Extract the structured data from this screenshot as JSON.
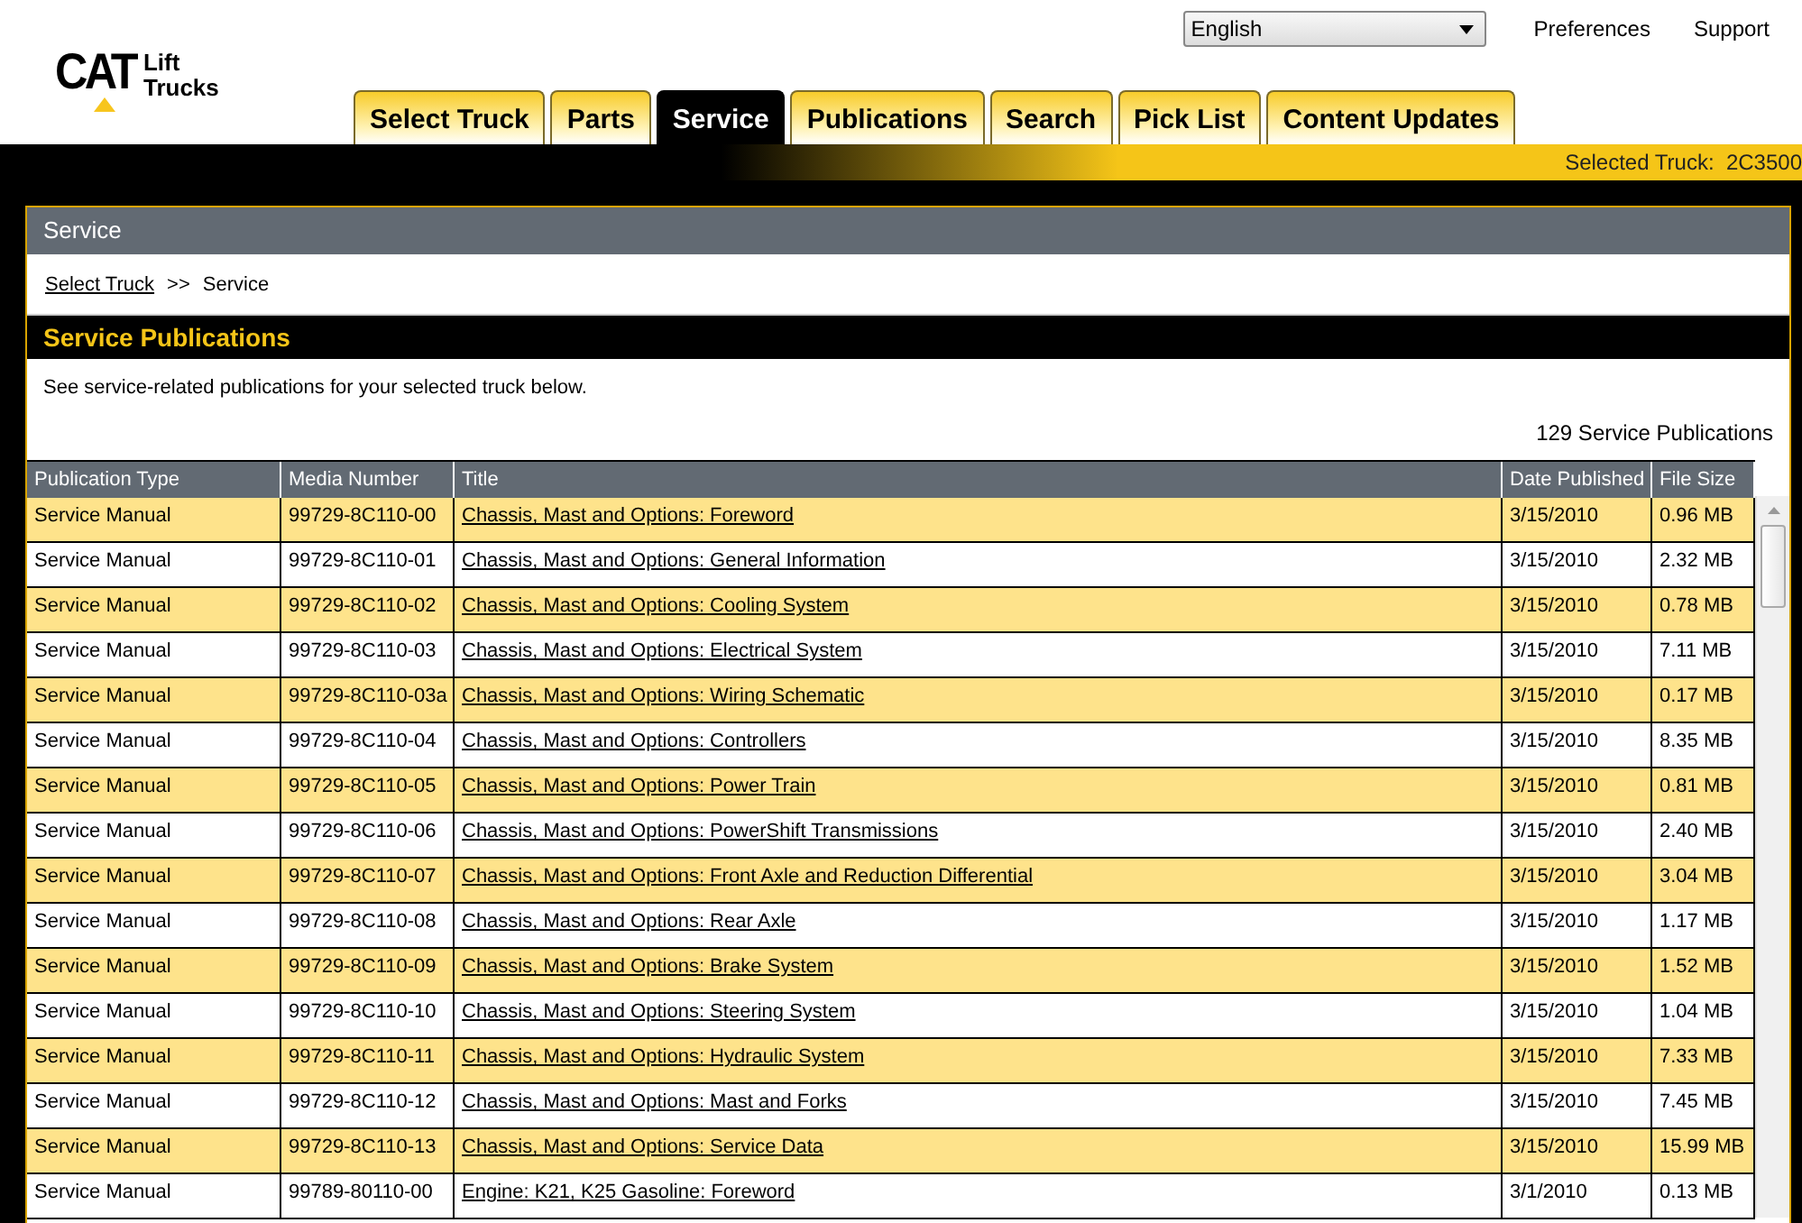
{
  "logo": {
    "brand": "CAT",
    "product_line_1": "Lift",
    "product_line_2": "Trucks"
  },
  "language_select": {
    "value": "English"
  },
  "header_links": [
    "Preferences",
    "Support"
  ],
  "tabs": [
    {
      "label": "Select Truck",
      "selected": false
    },
    {
      "label": "Parts",
      "selected": false
    },
    {
      "label": "Service",
      "selected": true
    },
    {
      "label": "Publications",
      "selected": false
    },
    {
      "label": "Search",
      "selected": false
    },
    {
      "label": "Pick List",
      "selected": false
    },
    {
      "label": "Content Updates",
      "selected": false
    }
  ],
  "selected_truck": {
    "label": "Selected Truck:",
    "value": "2C3500"
  },
  "panel": {
    "title": "Service",
    "breadcrumb": [
      {
        "label": "Select Truck",
        "kind": "link"
      },
      {
        "label": ">>",
        "kind": "separator"
      },
      {
        "label": "Service",
        "kind": "current"
      }
    ],
    "section_title": "Service Publications",
    "description": "See service-related publications for your selected truck below.",
    "count": "129 Service Publications"
  },
  "table": {
    "columns": [
      "Publication Type",
      "Media Number",
      "Title",
      "Date Published",
      "File Size"
    ],
    "rows": [
      [
        "Service Manual",
        "99729-8C110-00",
        "Chassis, Mast and Options: Foreword",
        "3/15/2010",
        "0.96 MB"
      ],
      [
        "Service Manual",
        "99729-8C110-01",
        "Chassis, Mast and Options: General Information",
        "3/15/2010",
        "2.32 MB"
      ],
      [
        "Service Manual",
        "99729-8C110-02",
        "Chassis, Mast and Options: Cooling System",
        "3/15/2010",
        "0.78 MB"
      ],
      [
        "Service Manual",
        "99729-8C110-03",
        "Chassis, Mast and Options: Electrical System",
        "3/15/2010",
        "7.11 MB"
      ],
      [
        "Service Manual",
        "99729-8C110-03a",
        "Chassis, Mast and Options: Wiring Schematic",
        "3/15/2010",
        "0.17 MB"
      ],
      [
        "Service Manual",
        "99729-8C110-04",
        "Chassis, Mast and Options: Controllers",
        "3/15/2010",
        "8.35 MB"
      ],
      [
        "Service Manual",
        "99729-8C110-05",
        "Chassis, Mast and Options: Power Train",
        "3/15/2010",
        "0.81 MB"
      ],
      [
        "Service Manual",
        "99729-8C110-06",
        "Chassis, Mast and Options: PowerShift Transmissions",
        "3/15/2010",
        "2.40 MB"
      ],
      [
        "Service Manual",
        "99729-8C110-07",
        "Chassis, Mast and Options: Front Axle and Reduction Differential",
        "3/15/2010",
        "3.04 MB"
      ],
      [
        "Service Manual",
        "99729-8C110-08",
        "Chassis, Mast and Options: Rear Axle",
        "3/15/2010",
        "1.17 MB"
      ],
      [
        "Service Manual",
        "99729-8C110-09",
        "Chassis, Mast and Options: Brake System",
        "3/15/2010",
        "1.52 MB"
      ],
      [
        "Service Manual",
        "99729-8C110-10",
        "Chassis, Mast and Options: Steering System",
        "3/15/2010",
        "1.04 MB"
      ],
      [
        "Service Manual",
        "99729-8C110-11",
        "Chassis, Mast and Options: Hydraulic System",
        "3/15/2010",
        "7.33 MB"
      ],
      [
        "Service Manual",
        "99729-8C110-12",
        "Chassis, Mast and Options: Mast and Forks",
        "3/15/2010",
        "7.45 MB"
      ],
      [
        "Service Manual",
        "99729-8C110-13",
        "Chassis, Mast and Options: Service Data",
        "3/15/2010",
        "15.99 MB"
      ],
      [
        "Service Manual",
        "99789-80110-00",
        "Engine: K21, K25 Gasoline: Foreword",
        "3/1/2010",
        "0.13 MB"
      ]
    ]
  }
}
